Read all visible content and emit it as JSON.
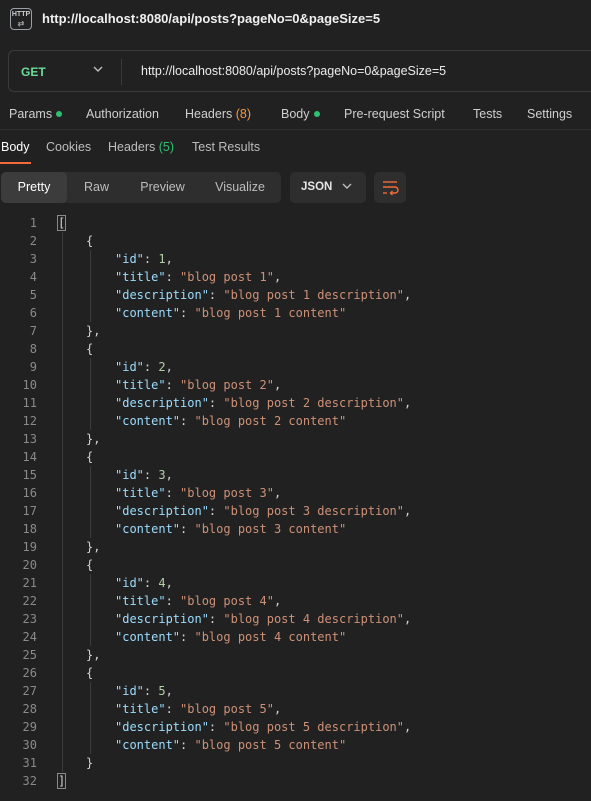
{
  "window": {
    "badge_text": "HTTP",
    "title_url": "http://localhost:8080/api/posts?pageNo=0&pageSize=5"
  },
  "request": {
    "method": "GET",
    "url": "http://localhost:8080/api/posts?pageNo=0&pageSize=5"
  },
  "request_tabs": {
    "params": "Params",
    "authorization": "Authorization",
    "headers": "Headers",
    "headers_count": "(8)",
    "body": "Body",
    "prerequest": "Pre-request Script",
    "tests": "Tests",
    "settings": "Settings"
  },
  "response_tabs": {
    "body": "Body",
    "cookies": "Cookies",
    "headers": "Headers",
    "headers_count": "(5)",
    "test_results": "Test Results"
  },
  "view_modes": [
    "Pretty",
    "Raw",
    "Preview",
    "Visualize"
  ],
  "active_view": "Pretty",
  "format": "JSON",
  "colors": {
    "method": "#6bdd9a",
    "active_underline": "#f26b3a",
    "key": "#9cdcfe",
    "string": "#ce9178",
    "number": "#b5cea8"
  },
  "posts": [
    {
      "id": 1,
      "title": "blog post 1",
      "description": "blog post 1 description",
      "content": "blog post 1 content"
    },
    {
      "id": 2,
      "title": "blog post 2",
      "description": "blog post 2 description",
      "content": "blog post 2 content"
    },
    {
      "id": 3,
      "title": "blog post 3",
      "description": "blog post 3 description",
      "content": "blog post 3 content"
    },
    {
      "id": 4,
      "title": "blog post 4",
      "description": "blog post 4 description",
      "content": "blog post 4 content"
    },
    {
      "id": 5,
      "title": "blog post 5",
      "description": "blog post 5 description",
      "content": "blog post 5 content"
    }
  ],
  "total_lines": 32
}
